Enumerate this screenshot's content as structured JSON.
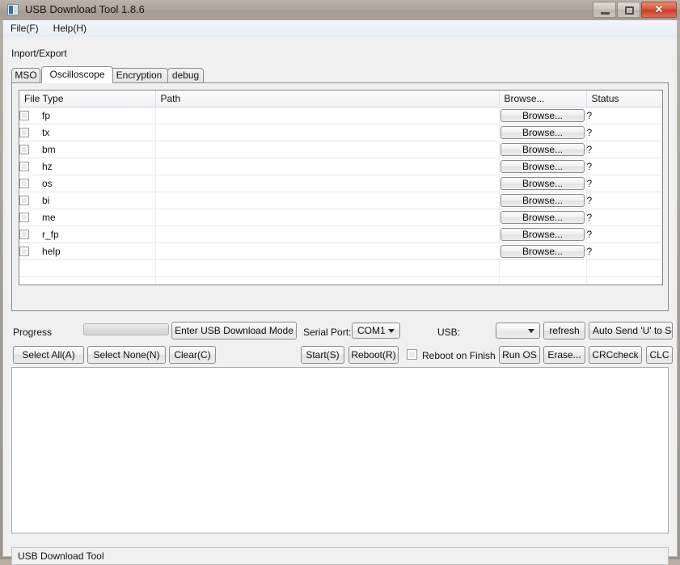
{
  "window": {
    "title": "USB Download Tool 1.8.6",
    "icon": "app-icon",
    "buttons": {
      "minimize": "minimize-icon",
      "maximize": "maximize-icon",
      "close": "✕"
    }
  },
  "menu": {
    "items": [
      {
        "label": "File(F)"
      },
      {
        "label": "Help(H)"
      }
    ]
  },
  "section_label": "Inport/Export",
  "tabs": [
    {
      "label": "MSO",
      "active": false
    },
    {
      "label": "Oscilloscope",
      "active": true
    },
    {
      "label": "Encryption",
      "active": false
    },
    {
      "label": "debug",
      "active": false
    }
  ],
  "table": {
    "headers": [
      "File Type",
      "Path",
      "Browse...",
      "Status"
    ],
    "browse_label": "Browse...",
    "rows": [
      {
        "checked": false,
        "type": "fp",
        "path": "",
        "browse": "Browse...",
        "status": "?"
      },
      {
        "checked": false,
        "type": "tx",
        "path": "",
        "browse": "Browse...",
        "status": "?"
      },
      {
        "checked": false,
        "type": "bm",
        "path": "",
        "browse": "Browse...",
        "status": "?"
      },
      {
        "checked": false,
        "type": "hz",
        "path": "",
        "browse": "Browse...",
        "status": "?"
      },
      {
        "checked": false,
        "type": "os",
        "path": "",
        "browse": "Browse...",
        "status": "?"
      },
      {
        "checked": false,
        "type": "bi",
        "path": "",
        "browse": "Browse...",
        "status": "?"
      },
      {
        "checked": false,
        "type": "me",
        "path": "",
        "browse": "Browse...",
        "status": "?"
      },
      {
        "checked": false,
        "type": "r_fp",
        "path": "",
        "browse": "Browse...",
        "status": "?"
      },
      {
        "checked": false,
        "type": "help",
        "path": "",
        "browse": "Browse...",
        "status": "?"
      }
    ]
  },
  "controls": {
    "progress_label": "Progress",
    "progress_value": 0,
    "enter_usb_download_mode": "Enter USB Download Mode",
    "serial_port_label": "Serial Port:",
    "serial_port_value": "COM1",
    "usb_label": "USB:",
    "usb_value": "",
    "refresh": "refresh",
    "auto_send": "Auto Send 'U' to Se",
    "select_all": "Select All(A)",
    "select_none": "Select None(N)",
    "clear": "Clear(C)",
    "start": "Start(S)",
    "reboot": "Reboot(R)",
    "reboot_on_finish_label": "Reboot on Finish",
    "reboot_on_finish_checked": false,
    "run_os": "Run OS",
    "erase": "Erase...",
    "crccheck": "CRCcheck",
    "clc": "CLC"
  },
  "log": {
    "content": ""
  },
  "statusbar": {
    "text": "USB Download Tool"
  },
  "colors": {
    "titlebar": "#ada49a",
    "client": "#f0f0f0",
    "close_button": "#d9543a",
    "accent": "#2f6fa8"
  }
}
